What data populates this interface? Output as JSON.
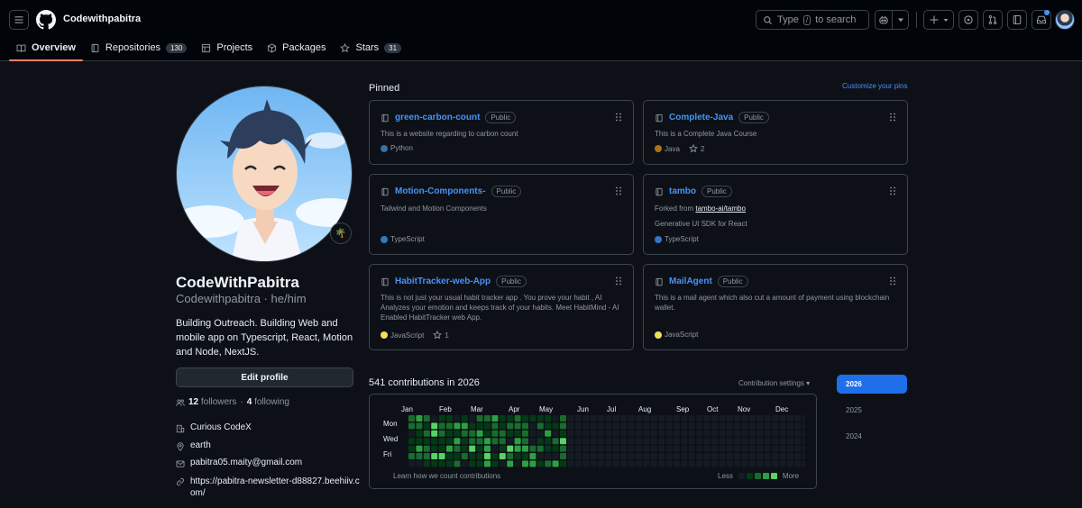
{
  "header": {
    "username": "Codewithpabitra",
    "search_prefix": "Type",
    "search_key": "/",
    "search_suffix": "to search"
  },
  "tabs": [
    {
      "label": "Overview",
      "count": null,
      "selected": true
    },
    {
      "label": "Repositories",
      "count": "130"
    },
    {
      "label": "Projects",
      "count": null
    },
    {
      "label": "Packages",
      "count": null
    },
    {
      "label": "Stars",
      "count": "31"
    }
  ],
  "profile": {
    "status_emoji": "🌴",
    "full_name": "CodeWithPabitra",
    "handle": "Codewithpabitra · he/him",
    "bio": "Building Outreach. Building Web and mobile app on Typescript, React, Motion and Node, NextJS.",
    "edit_label": "Edit profile",
    "followers": "12",
    "followers_label": "followers",
    "following": "4",
    "following_label": "following",
    "organization": "Curious CodeX",
    "location": "earth",
    "email": "pabitra05.maity@gmail.com",
    "website_line1": "https://pabitra-newsletter-d88827.beehiiv.c",
    "website_line2": "om/"
  },
  "pinned": {
    "title": "Pinned",
    "customize": "Customize your pins",
    "badge": "Public",
    "cards": [
      {
        "name": "green-carbon-count",
        "desc": "This is a website regarding to carbon count",
        "lang": "Python",
        "lang_color": "#3572A5",
        "stars": ""
      },
      {
        "name": "Complete-Java",
        "desc": "This is a Complete Java Course",
        "lang": "Java",
        "lang_color": "#b07219",
        "stars": "2"
      },
      {
        "name": "Motion-Components-",
        "desc": "Tailwind and Motion Components",
        "lang": "TypeScript",
        "lang_color": "#3178c6",
        "stars": ""
      },
      {
        "name": "tambo",
        "fork_prefix": "Forked from",
        "fork_link": "tambo-ai/tambo",
        "desc": "Generative UI SDK for React",
        "lang": "TypeScript",
        "lang_color": "#3178c6",
        "stars": ""
      },
      {
        "name": "HabitTracker-web-App",
        "desc": "This is not just your usual habit tracker app . You prove your habit , AI Analyzes your emotion and keeps track of your habits. Meet HabitMind - AI Enabled HabitTracker web App.",
        "lang": "JavaScript",
        "lang_color": "#f1e05a",
        "stars": "1"
      },
      {
        "name": "MailAgent",
        "desc": "This is a mail agent which also cut a amount of payment using blockchain wallet.",
        "lang": "JavaScript",
        "lang_color": "#f1e05a",
        "stars": ""
      }
    ]
  },
  "contributions": {
    "title": "541 contributions in 2026",
    "settings": "Contribution settings",
    "months": [
      "Jan",
      "Feb",
      "Mar",
      "Apr",
      "May",
      "Jun",
      "Jul",
      "Aug",
      "Sep",
      "Oct",
      "Nov",
      "Dec"
    ],
    "days": [
      "Mon",
      "Wed",
      "Fri"
    ],
    "learn": "Learn how we count contributions",
    "less": "Less",
    "more": "More",
    "years": [
      "2026",
      "2025",
      "2024"
    ]
  },
  "colors": {
    "accent": "#4493f8",
    "tab_underline": "#f78166",
    "year_active": "#1f6feb",
    "levels": [
      "#151b23",
      "#033a16",
      "#196c2e",
      "#2ea043",
      "#56d364"
    ]
  }
}
